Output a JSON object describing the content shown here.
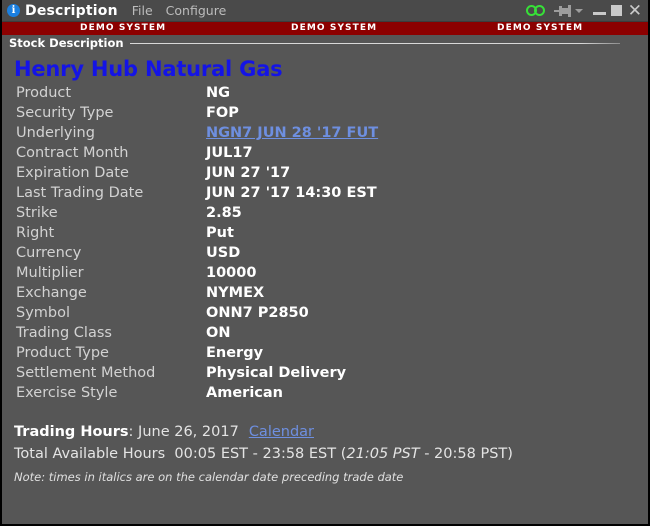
{
  "window": {
    "icon": "info-icon",
    "title": "Description",
    "menus": [
      {
        "label": "File"
      },
      {
        "label": "Configure"
      }
    ],
    "controls": {
      "link_icon": "chain-link-icon",
      "pin_icon": "pin-icon",
      "pin_dropdown_icon": "chevron-down-icon",
      "minimize": "minimize-button",
      "maximize": "maximize-button",
      "close": "✕"
    }
  },
  "demo_banner": {
    "text": "DEMO SYSTEM",
    "color": "#8c0000",
    "repeats": 3
  },
  "group": {
    "label": "Stock Description"
  },
  "instrument": {
    "name": "Henry Hub Natural Gas",
    "name_color": "#1414e6",
    "rows": [
      {
        "label": "Product",
        "value": "NG"
      },
      {
        "label": "Security Type",
        "value": "FOP"
      },
      {
        "label": "Underlying",
        "value": "NGN7 JUN 28 '17 FUT",
        "link": true
      },
      {
        "label": "Contract Month",
        "value": "JUL17"
      },
      {
        "label": "Expiration Date",
        "value": "JUN 27 '17"
      },
      {
        "label": "Last Trading Date",
        "value": "JUN 27 '17 14:30 EST"
      },
      {
        "label": "Strike",
        "value": "2.85"
      },
      {
        "label": "Right",
        "value": "Put"
      },
      {
        "label": "Currency",
        "value": "USD"
      },
      {
        "label": "Multiplier",
        "value": "10000"
      },
      {
        "label": "Exchange",
        "value": "NYMEX"
      },
      {
        "label": "Symbol",
        "value": "ONN7 P2850"
      },
      {
        "label": "Trading Class",
        "value": "ON"
      },
      {
        "label": "Product Type",
        "value": "Energy"
      },
      {
        "label": "Settlement Method",
        "value": "Physical Delivery"
      },
      {
        "label": "Exercise Style",
        "value": "American"
      }
    ]
  },
  "trading_hours": {
    "heading": "Trading Hours",
    "date_text": ": June 26, 2017",
    "calendar_link": "Calendar",
    "total_label": "Total Available Hours",
    "est_range": "00:05 EST - 23:58 EST",
    "pst_open_paren": "(",
    "pst_start_italic": "21:05 PST",
    "pst_sep": " - 20:58 PST)",
    "note": "Note: times in italics are on the calendar date preceding trade date"
  }
}
